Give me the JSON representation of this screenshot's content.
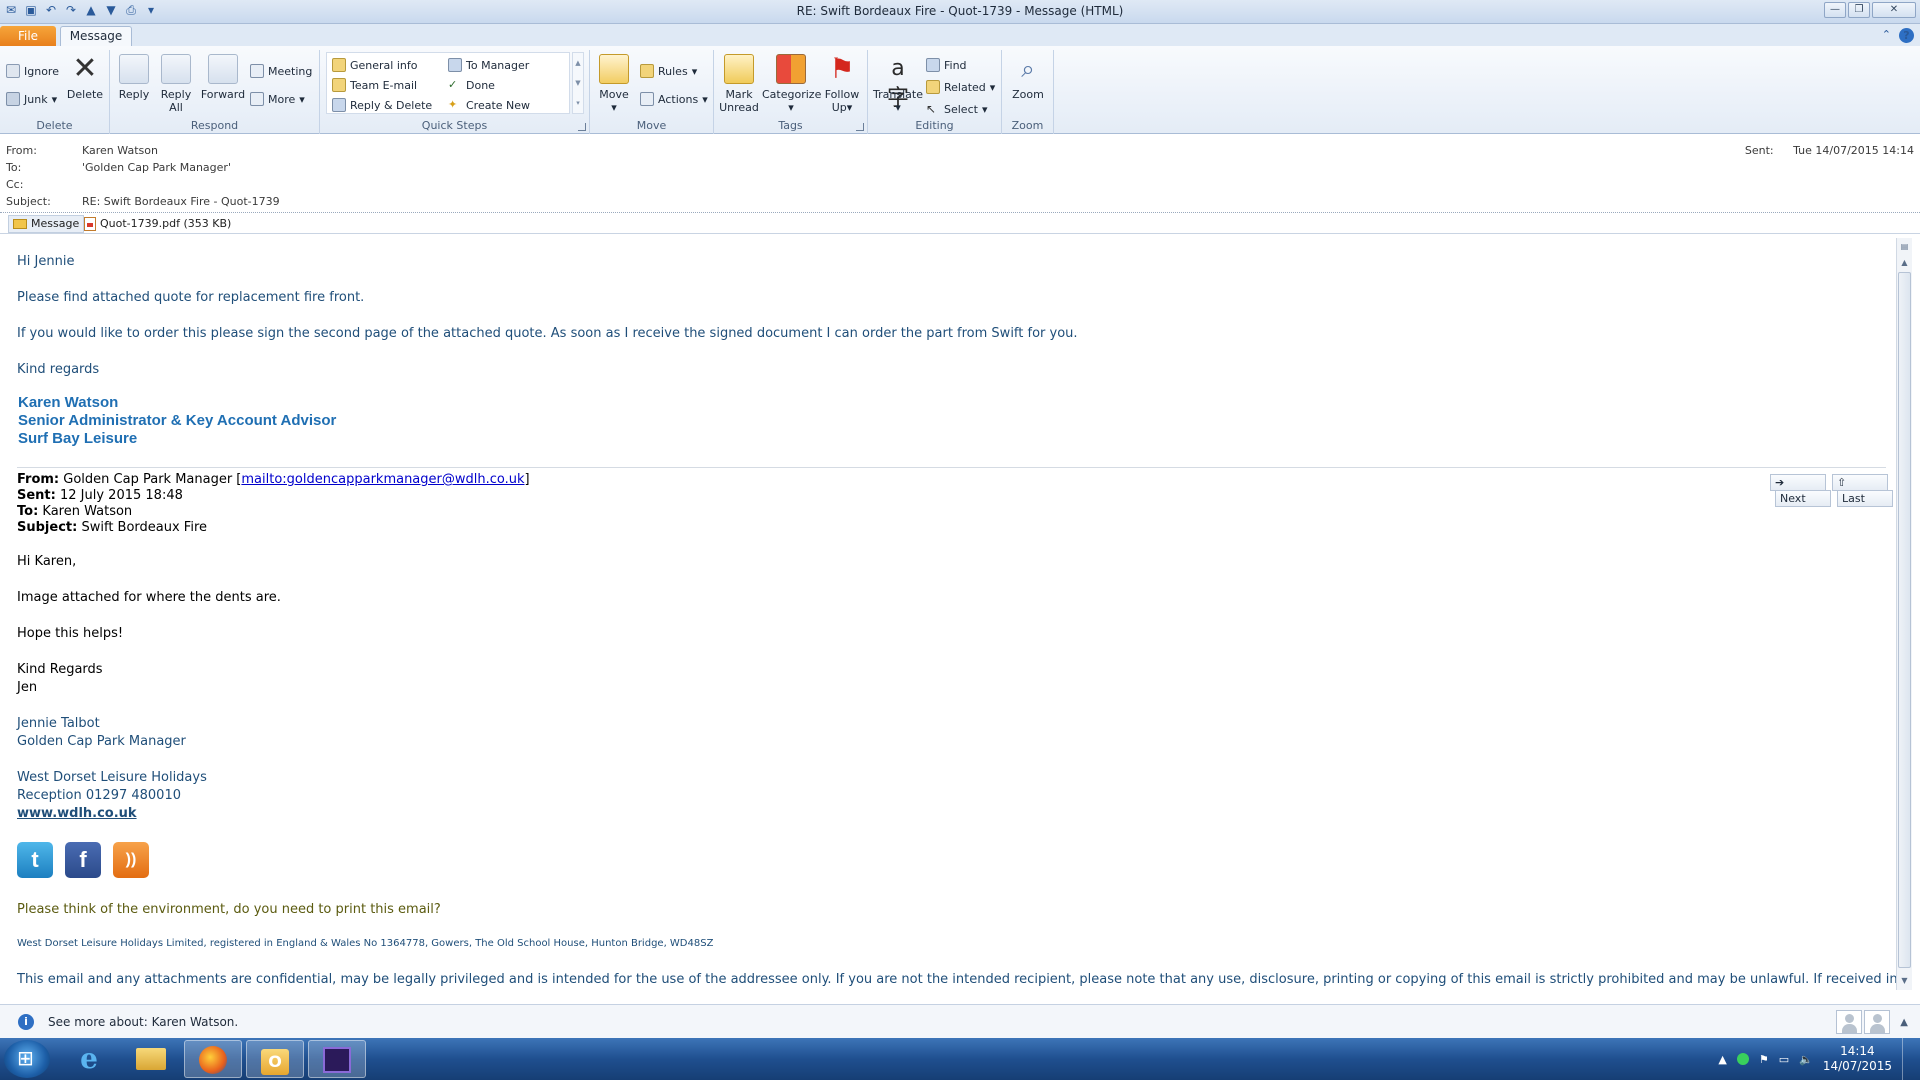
{
  "window": {
    "title": "RE: Swift Bordeaux Fire - Quot-1739  -  Message (HTML)"
  },
  "tabs": {
    "file": "File",
    "message": "Message"
  },
  "ribbon": {
    "delete": {
      "label": "Delete",
      "ignore": "Ignore",
      "junk": "Junk",
      "delete": "Delete"
    },
    "respond": {
      "label": "Respond",
      "reply": "Reply",
      "reply_all_1": "Reply",
      "reply_all_2": "All",
      "forward": "Forward",
      "meeting": "Meeting",
      "more": "More"
    },
    "quick_steps": {
      "label": "Quick Steps",
      "items": [
        "General info",
        "Team E-mail",
        "Reply & Delete",
        "To Manager",
        "Done",
        "Create New"
      ]
    },
    "move": {
      "label": "Move",
      "move": "Move",
      "rules": "Rules",
      "actions": "Actions"
    },
    "tags": {
      "label": "Tags",
      "mark_unread_1": "Mark",
      "mark_unread_2": "Unread",
      "categorize": "Categorize",
      "follow_up_1": "Follow",
      "follow_up_2": "Up"
    },
    "editing": {
      "label": "Editing",
      "translate": "Translate",
      "find": "Find",
      "related": "Related",
      "select": "Select"
    },
    "zoom": {
      "label": "Zoom",
      "zoom": "Zoom"
    }
  },
  "header": {
    "from_label": "From:",
    "from": "Karen Watson",
    "to_label": "To:",
    "to": "'Golden Cap Park Manager'",
    "cc_label": "Cc:",
    "cc": "",
    "subject_label": "Subject:",
    "subject": "RE: Swift Bordeaux Fire - Quot-1739",
    "sent_label": "Sent:",
    "sent": "Tue 14/07/2015 14:14"
  },
  "attachments": {
    "message_tab": "Message",
    "file": "Quot-1739.pdf (353 KB)"
  },
  "reply": {
    "greeting": "Hi Jennie",
    "line1": "Please find attached quote for replacement fire front.",
    "line2": "If you would like to order this please sign the second page of the attached quote. As soon as I receive the signed document I can order the part from Swift for you.",
    "closing": "Kind regards",
    "sig_name": "Karen Watson",
    "sig_title": "Senior Administrator & Key Account Advisor",
    "sig_company": "Surf Bay Leisure"
  },
  "quoted": {
    "from_label": "From:",
    "from": "Golden Cap Park Manager [",
    "mailto": "mailto:goldencapparkmanager@wdlh.co.uk",
    "from_end": "]",
    "sent_label": "Sent:",
    "sent": "12 July 2015 18:48",
    "to_label": "To:",
    "to": "Karen Watson",
    "subject_label": "Subject:",
    "subject": "Swift Bordeaux Fire",
    "greeting": "Hi Karen,",
    "line1": "Image attached for where the dents are.",
    "line2": "Hope this helps!",
    "closing1": "Kind Regards",
    "closing2": "Jen",
    "sig_name": "Jennie Talbot",
    "sig_title": "Golden Cap Park Manager",
    "company": "West Dorset Leisure Holidays",
    "reception": "Reception 01297 480010",
    "website": "www.wdlh.co.uk",
    "env": "Please think of the environment, do you need to print this email?",
    "registered": "West Dorset Leisure Holidays Limited, registered in England & Wales No 1364778, Gowers, The Old School House, Hunton Bridge, WD48SZ",
    "disclaimer": "This email and any attachments are confidential, may be legally privileged and is intended for the use of the addressee only. If you are not the intended recipient, please note that any use, disclosure, printing or copying of this email is strictly prohibited and may be unlawful. If received in error, please return"
  },
  "nav": {
    "next": "Next",
    "last": "Last"
  },
  "people_pane": {
    "text": "See more about: Karen Watson."
  },
  "taskbar": {
    "time": "14:14",
    "date": "14/07/2015"
  }
}
